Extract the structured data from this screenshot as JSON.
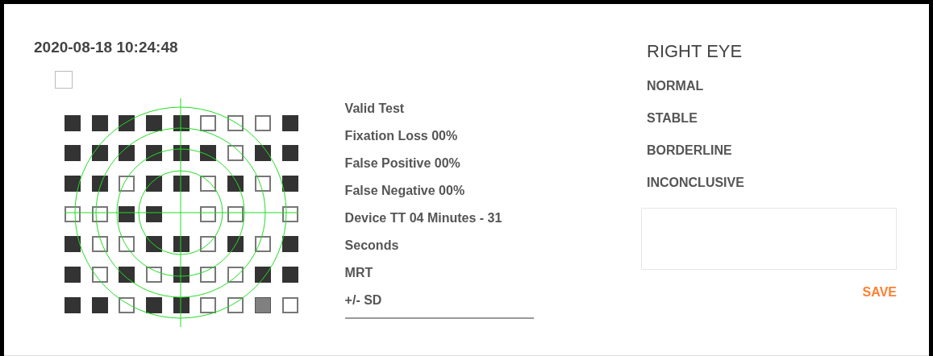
{
  "timestamp": "2020-08-18 10:24:48",
  "checkbox": {
    "checked": false
  },
  "field_grid": {
    "rows": [
      {
        "cells": [
          {
            "kind": "filled"
          },
          {
            "kind": "filled"
          },
          {
            "kind": "filled"
          },
          {
            "kind": "filled"
          },
          {
            "kind": "filled"
          },
          {
            "kind": "empty"
          },
          {
            "kind": "empty"
          },
          {
            "kind": "empty"
          },
          {
            "kind": "filled"
          }
        ]
      },
      {
        "cells": [
          {
            "kind": "filled"
          },
          {
            "kind": "filled"
          },
          {
            "kind": "filled"
          },
          {
            "kind": "filled"
          },
          {
            "kind": "filled"
          },
          {
            "kind": "filled"
          },
          {
            "kind": "empty"
          },
          {
            "kind": "filled"
          },
          {
            "kind": "filled"
          }
        ]
      },
      {
        "cells": [
          {
            "kind": "filled"
          },
          {
            "kind": "filled"
          },
          {
            "kind": "empty"
          },
          {
            "kind": "filled"
          },
          {
            "kind": "filled"
          },
          {
            "kind": "empty"
          },
          {
            "kind": "filled"
          },
          {
            "kind": "empty"
          },
          {
            "kind": "filled"
          }
        ]
      },
      {
        "cells": [
          {
            "kind": "empty"
          },
          {
            "kind": "empty"
          },
          {
            "kind": "filled"
          },
          {
            "kind": "filled"
          },
          {
            "kind": "none"
          },
          {
            "kind": "empty"
          },
          {
            "kind": "empty"
          },
          {
            "kind": "none"
          },
          {
            "kind": "empty"
          }
        ]
      },
      {
        "cells": [
          {
            "kind": "filled"
          },
          {
            "kind": "empty"
          },
          {
            "kind": "empty"
          },
          {
            "kind": "filled"
          },
          {
            "kind": "filled"
          },
          {
            "kind": "empty"
          },
          {
            "kind": "filled"
          },
          {
            "kind": "empty"
          },
          {
            "kind": "filled"
          }
        ]
      },
      {
        "cells": [
          {
            "kind": "filled"
          },
          {
            "kind": "empty"
          },
          {
            "kind": "filled"
          },
          {
            "kind": "empty"
          },
          {
            "kind": "filled"
          },
          {
            "kind": "empty"
          },
          {
            "kind": "empty"
          },
          {
            "kind": "filled"
          },
          {
            "kind": "filled"
          }
        ]
      },
      {
        "cells": [
          {
            "kind": "filled"
          },
          {
            "kind": "filled"
          },
          {
            "kind": "empty"
          },
          {
            "kind": "filled"
          },
          {
            "kind": "filled"
          },
          {
            "kind": "empty"
          },
          {
            "kind": "empty"
          },
          {
            "kind": "gray"
          },
          {
            "kind": "empty"
          }
        ]
      }
    ]
  },
  "stats": [
    "Valid Test",
    "Fixation Loss 00%",
    "False Positive 00%",
    "False Negative 00%",
    "Device TT 04 Minutes - 31",
    "Seconds",
    "MRT",
    "+/- SD"
  ],
  "eye_title": "RIGHT EYE",
  "options": [
    "NORMAL",
    "STABLE",
    "BORDERLINE",
    "INCONCLUSIVE"
  ],
  "save_button": "SAVE"
}
